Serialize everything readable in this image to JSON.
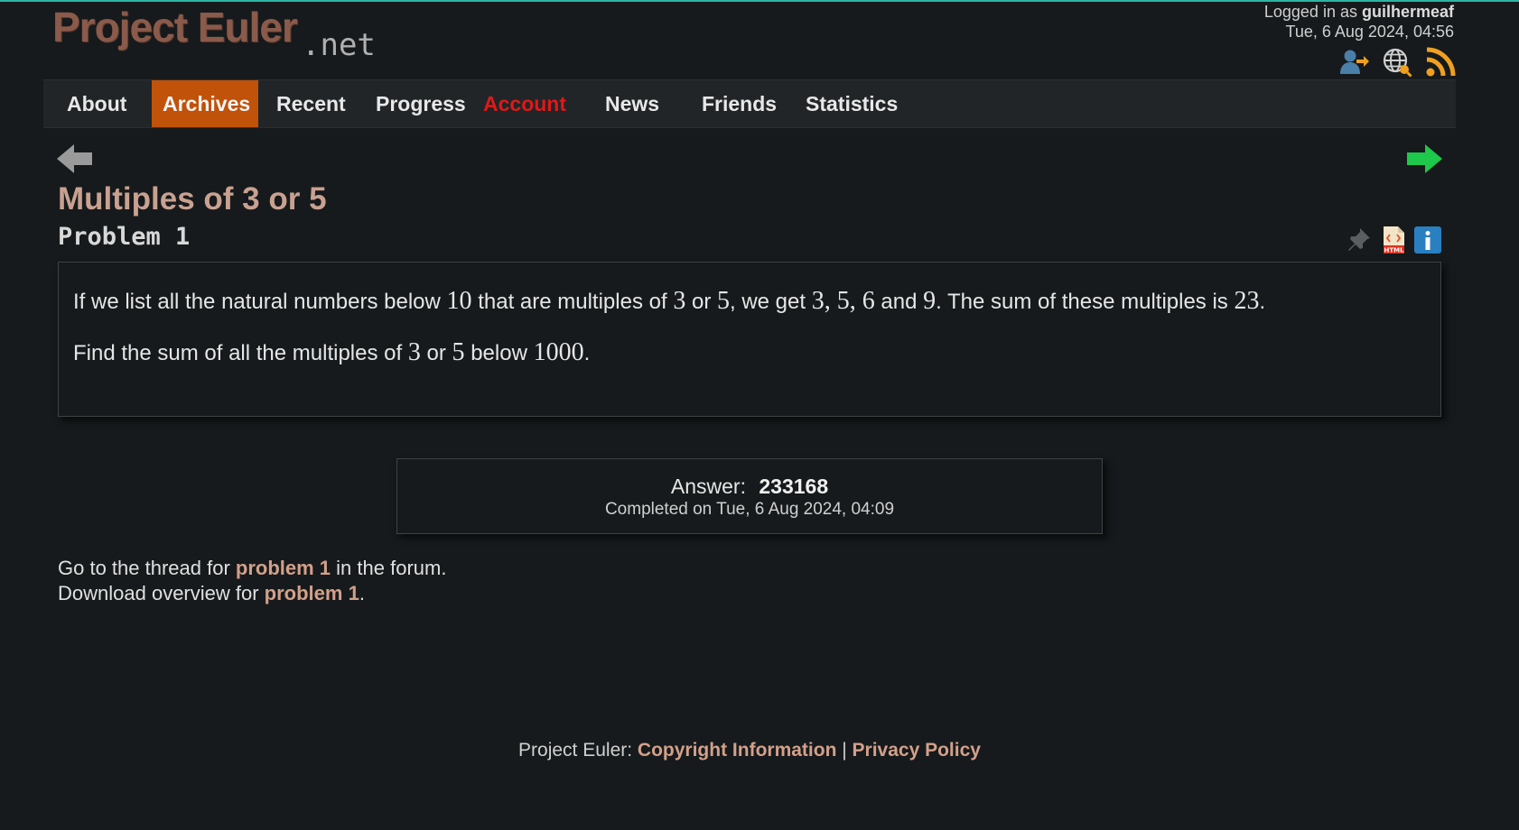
{
  "header": {
    "logo_main": "Project Euler",
    "logo_suffix": ".net",
    "logged_in_prefix": "Logged in as ",
    "username": "guilhermeaf",
    "datetime": "Tue, 6 Aug 2024, 04:56",
    "icons": [
      "logout-icon",
      "language-icon",
      "rss-icon"
    ]
  },
  "nav": {
    "items": [
      {
        "label": "About"
      },
      {
        "label": "Archives",
        "active": true
      },
      {
        "label": "Recent"
      },
      {
        "label": "Progress"
      },
      {
        "label": "Account"
      },
      {
        "label": "News"
      },
      {
        "label": "Friends"
      },
      {
        "label": "Statistics"
      }
    ]
  },
  "problem": {
    "title": "Multiples of 3 or 5",
    "number_label": "Problem 1",
    "para1": {
      "t1": "If we list all the natural numbers below ",
      "m1": "10",
      "t2": " that are multiples of ",
      "m2": "3",
      "t3": " or ",
      "m3": "5",
      "t4": ", we get ",
      "m4": "3, 5, 6",
      "t5": " and ",
      "m5": "9",
      "t6": ". The sum of these multiples is ",
      "m6": "23",
      "t7": "."
    },
    "para2": {
      "t1": "Find the sum of all the multiples of ",
      "m1": "3",
      "t2": " or ",
      "m2": "5",
      "t3": " below ",
      "m3": "1000",
      "t4": "."
    },
    "icons": [
      "pin-icon",
      "html-file-icon",
      "info-icon"
    ]
  },
  "answer": {
    "label": "Answer:",
    "value": "233168",
    "completed": "Completed on Tue, 6 Aug 2024, 04:09"
  },
  "links": {
    "thread_prefix": "Go to the thread for ",
    "thread_link": "problem 1",
    "thread_suffix": " in the forum.",
    "download_prefix": "Download overview for ",
    "download_link": "problem 1",
    "download_suffix": "."
  },
  "footer": {
    "prefix": "Project Euler: ",
    "copyright": "Copyright Information",
    "separator": " | ",
    "privacy": "Privacy Policy"
  },
  "colors": {
    "background": "#161a1c",
    "accent_orange": "#c0520a",
    "link": "#d3a08a",
    "account_red": "#e01818",
    "next_arrow": "#1ec84a"
  }
}
